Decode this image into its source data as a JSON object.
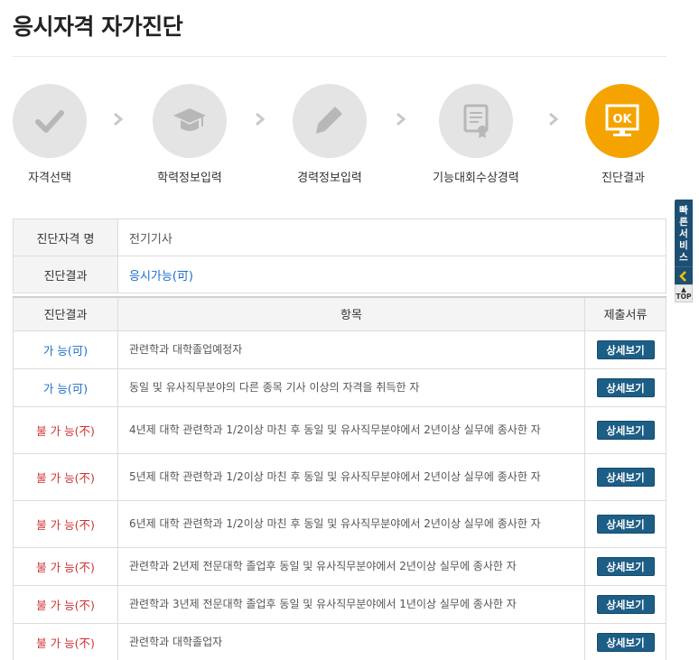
{
  "page_title": "응시자격 자가진단",
  "steps": [
    {
      "label": "자격선택",
      "icon": "checkmark-icon"
    },
    {
      "label": "학력정보입력",
      "icon": "graduation-cap-icon"
    },
    {
      "label": "경력정보입력",
      "icon": "pencil-icon"
    },
    {
      "label": "기능대회수상경력",
      "icon": "certificate-icon"
    },
    {
      "label": "진단결과",
      "icon": "monitor-ok-icon",
      "active": true,
      "icon_text": "OK"
    }
  ],
  "info": {
    "qualification_label": "진단자격 명",
    "qualification_value": "전기기사",
    "result_label": "진단결과",
    "result_value": "응시가능(可)"
  },
  "result_table": {
    "headers": [
      "진단결과",
      "항목",
      "제출서류"
    ],
    "button_label": "상세보기",
    "rows": [
      {
        "status": "가 능(可)",
        "item": "관련학과 대학졸업예정자"
      },
      {
        "status": "가 능(可)",
        "item": "동일 및 유사직무분야의 다른 종목 기사 이상의 자격을 취득한 자"
      },
      {
        "status": "불 가 능(不)",
        "item": "4년제 대학 관련학과 1/2이상 마친 후 동일 및 유사직무분야에서 2년이상 실무에 종사한 자"
      },
      {
        "status": "불 가 능(不)",
        "item": "5년제 대학 관련학과 1/2이상 마친 후 동일 및 유사직무분야에서 2년이상 실무에 종사한 자"
      },
      {
        "status": "불 가 능(不)",
        "item": "6년제 대학 관련학과 1/2이상 마친 후 동일 및 유사직무분야에서 2년이상 실무에 종사한 자"
      },
      {
        "status": "불 가 능(不)",
        "item": "관련학과 2년제 전문대학 졸업후 동일 및 유사직무분야에서 2년이상 실무에 종사한 자"
      },
      {
        "status": "불 가 능(不)",
        "item": "관련학과 3년제 전문대학 졸업후 동일 및 유사직무분야에서 1년이상 실무에 종사한 자"
      },
      {
        "status": "불 가 능(不)",
        "item": "관련학과 대학졸업자"
      }
    ]
  },
  "quick_service": {
    "label": "빠른서비스",
    "top_label": "TOP"
  },
  "colors": {
    "active_step": "#f4a300",
    "inactive_step": "#e4e4e4",
    "possible": "#1a6fc9",
    "impossible": "#d03030",
    "button": "#1d5e86"
  }
}
